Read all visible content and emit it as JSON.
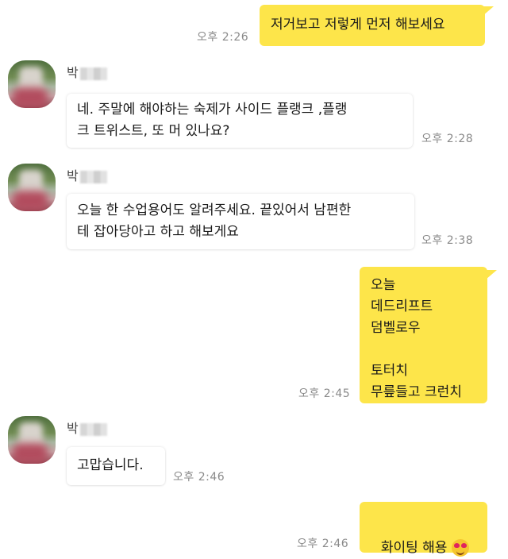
{
  "messages": [
    {
      "sender": "me",
      "text": "저거보고 저렇게 먼저 해보세요",
      "time": "오후 2:26"
    },
    {
      "sender": "other",
      "name": "박",
      "text": "네. 주말에 해야하는 숙제가 사이드 플랭크 ,플랭\n크 트위스트, 또 머 있나요?",
      "time": "오후 2:28"
    },
    {
      "sender": "other",
      "name": "박",
      "text": "오늘 한 수업용어도 알려주세요. 끝있어서 남편한\n테 잡아당아고 하고 해보게요",
      "time": "오후 2:38"
    },
    {
      "sender": "me",
      "text": "오늘\n데드리프트\n덤벨로우\n\n토터치\n무릎들고 크런치",
      "time": "오후 2:45"
    },
    {
      "sender": "other",
      "name": "박",
      "text": "고맙습니다.",
      "time": "오후 2:46"
    },
    {
      "sender": "me",
      "text": "화이팅 해용",
      "time": "오후 2:46",
      "emoji": "heart-eyes-emoji"
    }
  ],
  "colors": {
    "my_bubble": "#fde54a",
    "their_bubble": "#ffffff",
    "time": "#8a8a8a"
  }
}
